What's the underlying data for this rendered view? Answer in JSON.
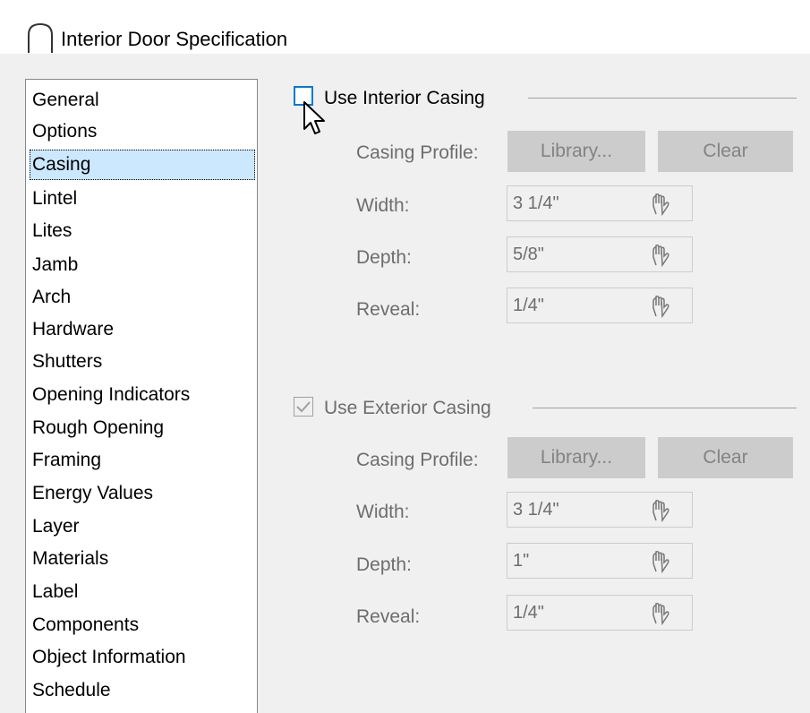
{
  "window": {
    "title": "Interior Door Specification"
  },
  "sidebar": {
    "items": [
      {
        "label": "General"
      },
      {
        "label": "Options"
      },
      {
        "label": "Casing",
        "selected": true
      },
      {
        "label": "Lintel"
      },
      {
        "label": "Lites"
      },
      {
        "label": "Jamb"
      },
      {
        "label": "Arch"
      },
      {
        "label": "Hardware"
      },
      {
        "label": "Shutters"
      },
      {
        "label": "Opening Indicators"
      },
      {
        "label": "Rough Opening"
      },
      {
        "label": "Framing"
      },
      {
        "label": "Energy Values"
      },
      {
        "label": "Layer"
      },
      {
        "label": "Materials"
      },
      {
        "label": "Label"
      },
      {
        "label": "Components"
      },
      {
        "label": "Object Information"
      },
      {
        "label": "Schedule"
      }
    ]
  },
  "interior": {
    "checkbox_label": "Use Interior Casing",
    "checked": false,
    "profile_label": "Casing Profile:",
    "library_button": "Library...",
    "clear_button": "Clear",
    "width_label": "Width:",
    "width_value": "3 1/4\"",
    "depth_label": "Depth:",
    "depth_value": "5/8\"",
    "reveal_label": "Reveal:",
    "reveal_value": "1/4\""
  },
  "exterior": {
    "checkbox_label": "Use Exterior Casing",
    "checked": true,
    "profile_label": "Casing Profile:",
    "library_button": "Library...",
    "clear_button": "Clear",
    "width_label": "Width:",
    "width_value": "3 1/4\"",
    "depth_label": "Depth:",
    "depth_value": "1\"",
    "reveal_label": "Reveal:",
    "reveal_value": "1/4\""
  },
  "icons": {
    "title": "arch-door-icon",
    "field_tool": "magnet-hand-icon"
  },
  "colors": {
    "selection": "#cce8ff",
    "focus_border": "#0078d7",
    "disabled_text": "#6d6d6d"
  }
}
